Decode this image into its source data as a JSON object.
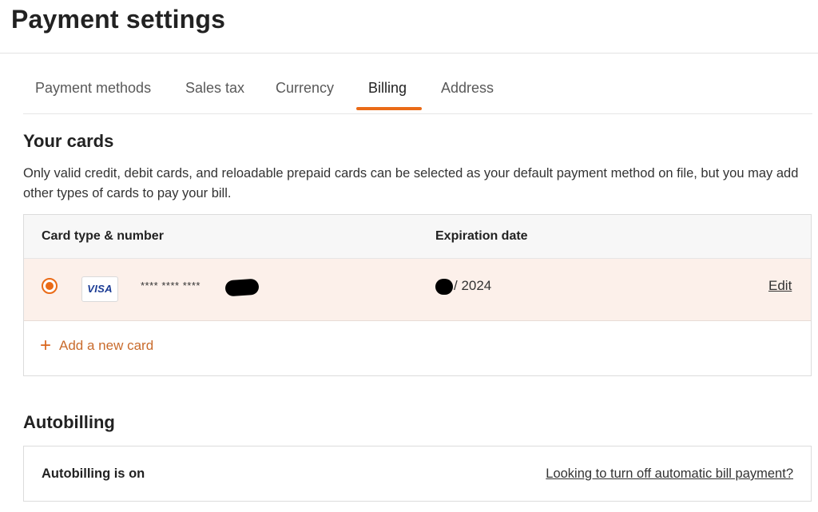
{
  "page": {
    "title": "Payment settings"
  },
  "tabs": [
    {
      "label": "Payment methods",
      "active": false
    },
    {
      "label": "Sales tax",
      "active": false
    },
    {
      "label": "Currency",
      "active": false
    },
    {
      "label": "Billing",
      "active": true
    },
    {
      "label": "Address",
      "active": false
    }
  ],
  "cards_section": {
    "heading": "Your cards",
    "description": "Only valid credit, debit cards, and reloadable prepaid cards can be selected as your default payment method on file, but you may add other types of cards to pay your bill.",
    "columns": {
      "card": "Card type & number",
      "expiration": "Expiration date"
    },
    "cards": [
      {
        "brand": "VISA",
        "number_masked": "**** **** ****",
        "expiration_year": "/ 2024",
        "edit_label": "Edit",
        "selected": true
      }
    ],
    "add_card_label": "Add a new card",
    "add_icon": "plus-icon"
  },
  "autobilling": {
    "heading": "Autobilling",
    "status": "Autobilling is on",
    "link_label": "Looking to turn off automatic bill payment?"
  },
  "colors": {
    "accent": "#ea6b17",
    "selected_row_bg": "#fcf0ea",
    "add_link": "#c96b2c"
  }
}
